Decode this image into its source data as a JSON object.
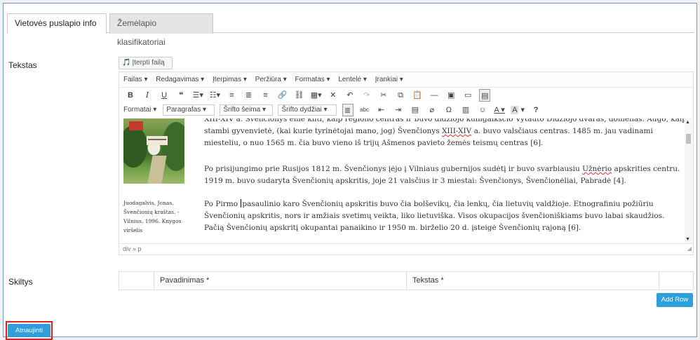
{
  "tabs": [
    {
      "label": "Vietovės puslapio info",
      "active": true
    },
    {
      "label": "Žemėlapio klasifikatoriai",
      "active": false
    }
  ],
  "tekstas_label": "Tekstas",
  "insert_file_label": "Įterpti failą",
  "menubar": [
    "Failas ▾",
    "Redagavimas ▾",
    "Įterpimas ▾",
    "Peržiūra ▾",
    "Formatas ▾",
    "Lentelė ▾",
    "Įrankiai ▾"
  ],
  "format_toolbar": {
    "formats": "Formatai ▾",
    "paragraph": "Paragrafas",
    "font_family": "Šrifto šeima",
    "font_size": "Šrifto dydžiai"
  },
  "content": {
    "caption": "Juodagalvis, Jonas. Švenčionių kraštas. - Vilnius, 1996. Knygos viršelis",
    "p1a": "XIII-XIV a. Švenčionys ėmė kilti, kaip regiono centras ir buvo didžiojo kunigaikščio Vytauto Didžiojo dvaras, domenas. Augo, kaip stambi gyvenvietė, (kai kurie tyrinėtojai mano, jog) Švenčionys ",
    "p1_err": "XIII-XIV",
    "p1b": " a. buvo valsčiaus centras. 1485 m. jau vadinami miesteliu, o nuo 1565 m. čia buvo vieno iš trijų Ašmenos pavieto žemės teismų centras [6].",
    "p2a": "Po prisijungimo prie Rusijos 1812 m. Švenčionys įėjo į Vilniaus gubernijos sudėtį ir buvo svarbiausiu ",
    "p2_err": "Užnėrio",
    "p2b": " apskrities centru. 1919 m. buvo sudaryta Švenčionių apskritis, joje 21 valsčius ir 3 miestai: Švenčionys, Švenčionėliai, Pabradė [4].",
    "p3a": "Po Pirmo ",
    "p3b": "pasaulinio karo Švenčionių apskritis buvo čia bolševikų, čia lenkų, čia lietuvių valdžioje. Etnografiniu požiūriu Švenčionių apskritis, nors ir amžiais svetimų veikta, liko lietuviška. Visos okupacijos švenčioniškiams buvo labai skaudžios. Pačią Švenčionių apskritį okupantai panaikino ir 1950 m. birželio 20 d. įsteigė Švenčionių rajoną [6]."
  },
  "statusbar": "div » p",
  "skiltys_label": "Skiltys",
  "table_headers": [
    "Pavadinimas *",
    "Tekstas *"
  ],
  "add_row_label": "Add Row",
  "update_label": "Atnaujinti"
}
